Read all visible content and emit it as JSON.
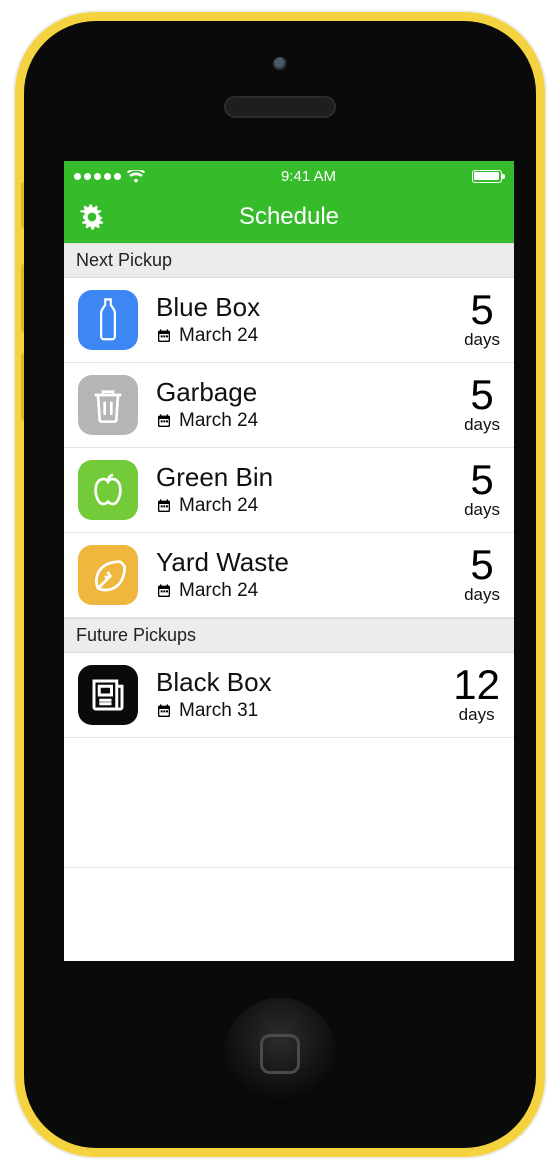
{
  "status": {
    "time": "9:41 AM"
  },
  "nav": {
    "title": "Schedule"
  },
  "sections": [
    {
      "header": "Next Pickup",
      "items": [
        {
          "icon": "bottle",
          "color": "ic-blue",
          "name": "blue-box",
          "title": "Blue Box",
          "date": "March 24",
          "count": "5",
          "unit": "days"
        },
        {
          "icon": "trash",
          "color": "ic-gray",
          "name": "garbage",
          "title": "Garbage",
          "date": "March 24",
          "count": "5",
          "unit": "days"
        },
        {
          "icon": "apple",
          "color": "ic-green",
          "name": "green-bin",
          "title": "Green Bin",
          "date": "March 24",
          "count": "5",
          "unit": "days"
        },
        {
          "icon": "leaf",
          "color": "ic-yellow",
          "name": "yard-waste",
          "title": "Yard Waste",
          "date": "March 24",
          "count": "5",
          "unit": "days"
        }
      ]
    },
    {
      "header": "Future Pickups",
      "items": [
        {
          "icon": "news",
          "color": "ic-black",
          "name": "black-box",
          "title": "Black Box",
          "date": "March 31",
          "count": "12",
          "unit": "days"
        }
      ]
    }
  ]
}
